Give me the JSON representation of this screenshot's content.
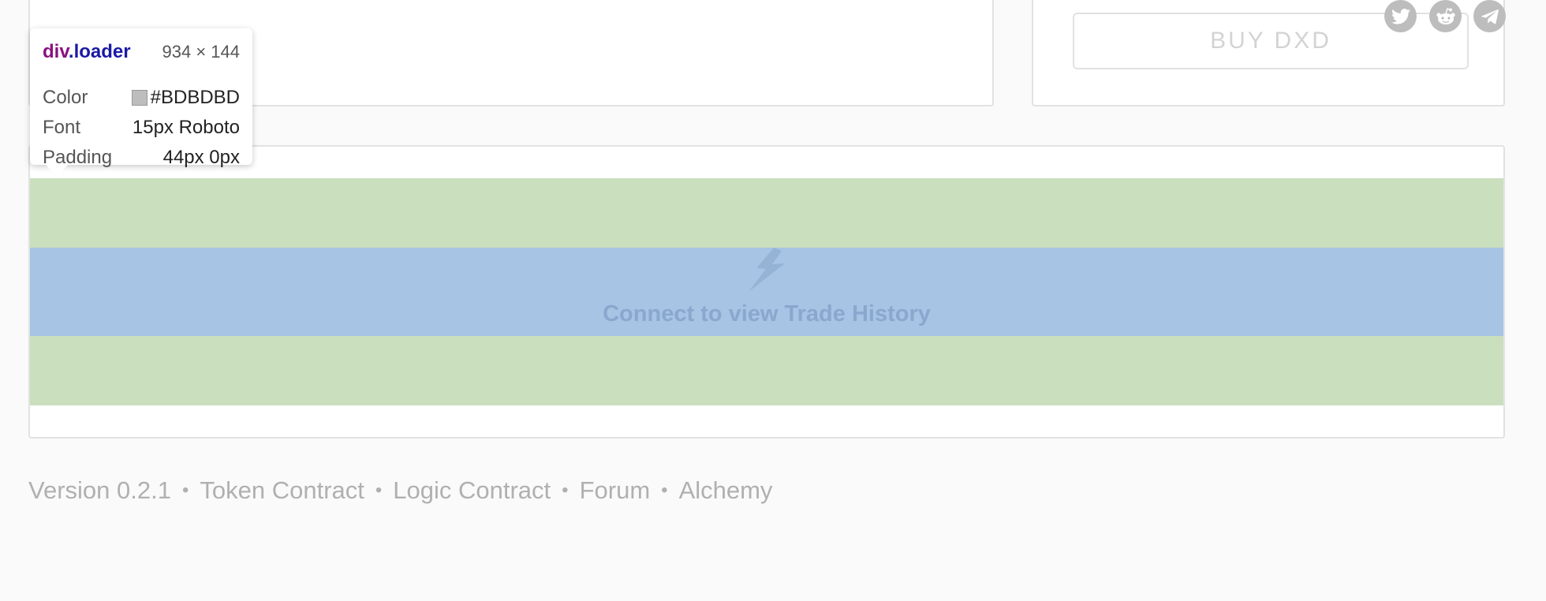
{
  "buy_panel": {
    "buy_label": "BUY DXD"
  },
  "trade_history": {
    "loader_text": "Connect to view Trade History"
  },
  "inspector_tooltip": {
    "element_tag": "div",
    "element_class": ".loader",
    "element_size": "934 × 144",
    "rows": [
      {
        "label": "Color",
        "value": "#BDBDBD"
      },
      {
        "label": "Font",
        "value": "15px Roboto"
      },
      {
        "label": "Padding",
        "value": "44px 0px"
      }
    ],
    "swatch_color": "#BDBDBD"
  },
  "footer": {
    "version": "Version 0.2.1",
    "links": [
      "Token Contract",
      "Logic Contract",
      "Forum",
      "Alchemy"
    ],
    "separator": "•"
  },
  "social": {
    "icons": [
      "twitter-icon",
      "reddit-icon",
      "telegram-icon"
    ],
    "icon_color": "#BDBDBD"
  },
  "colors": {
    "loader_margin": "#CADFBD",
    "loader_content": "#A7C4E4",
    "loader_text": "#8AA8CE",
    "footer_text": "#B0B0B0"
  }
}
